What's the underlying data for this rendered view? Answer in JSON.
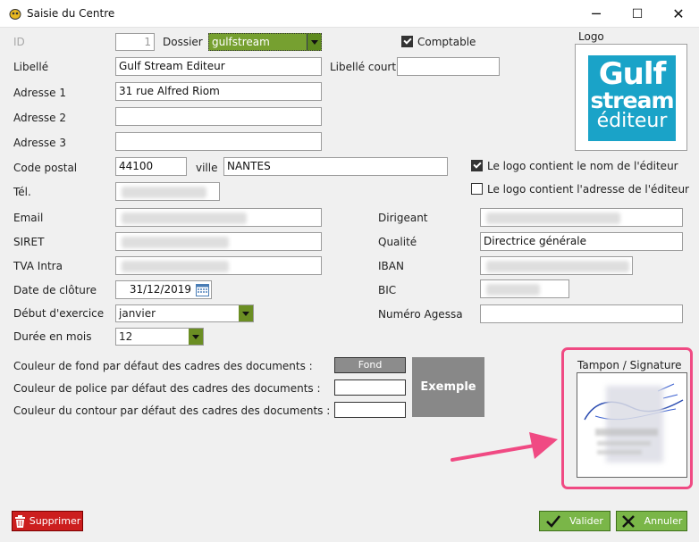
{
  "window": {
    "title": "Saisie du Centre",
    "minimize": "─",
    "maximize": "☐",
    "close": "✕"
  },
  "form": {
    "id_label": "ID",
    "id_value": "1",
    "dossier_label": "Dossier",
    "dossier_value": "gulfstream",
    "comptable_label": "Comptable",
    "comptable_checked": true,
    "logo_label": "Logo",
    "libelle_label": "Libellé",
    "libelle_value": "Gulf Stream Editeur",
    "libelle_court_label": "Libellé court",
    "libelle_court_value": "",
    "adresse1_label": "Adresse 1",
    "adresse1_value": "31 rue Alfred Riom",
    "adresse2_label": "Adresse 2",
    "adresse2_value": "",
    "adresse3_label": "Adresse 3",
    "adresse3_value": "",
    "code_postal_label": "Code postal",
    "code_postal_value": "44100",
    "ville_label": "ville",
    "ville_value": "NANTES",
    "logo_nom_label": "Le logo contient le nom de l'éditeur",
    "logo_nom_checked": true,
    "logo_adresse_label": "Le logo contient l'adresse de l'éditeur",
    "logo_adresse_checked": false,
    "tel_label": "Tél.",
    "email_label": "Email",
    "dirigeant_label": "Dirigeant",
    "siret_label": "SIRET",
    "qualite_label": "Qualité",
    "qualite_value": "Directrice générale",
    "tva_label": "TVA Intra",
    "iban_label": "IBAN",
    "date_cloture_label": "Date de clôture",
    "date_cloture_value": "31/12/2019",
    "bic_label": "BIC",
    "debut_exercice_label": "Début d'exercice",
    "debut_exercice_value": "janvier",
    "numero_agessa_label": "Numéro Agessa",
    "numero_agessa_value": "",
    "duree_label": "Durée en mois",
    "duree_value": "12"
  },
  "colors": {
    "fond_label": "Couleur de fond par défaut des cadres des documents :",
    "fond_swatch": "Fond",
    "police_label": "Couleur de police par défaut des cadres des documents :",
    "contour_label": "Couleur du contour par défaut des cadres des documents :",
    "exemple_label": "Exemple"
  },
  "logo_text": {
    "line1": "Gulf",
    "line2": "stream",
    "line3": "éditeur"
  },
  "stamp": {
    "label": "Tampon / Signature"
  },
  "buttons": {
    "delete": "Supprimer",
    "ok": "Valider",
    "cancel": "Annuler"
  },
  "palette": {
    "accent_green": "#7ab648",
    "danger_red": "#cc1e1e",
    "highlight_pink": "#f04a83",
    "logo_blue": "#1aa3c8"
  }
}
